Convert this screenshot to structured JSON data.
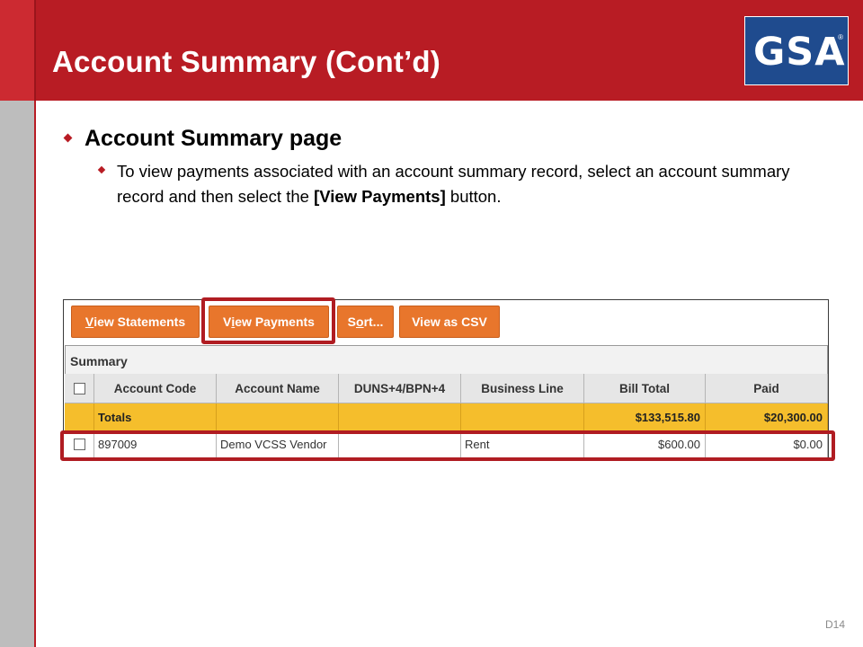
{
  "slide": {
    "title": "Account Summary (Cont’d)",
    "logo": "GSA",
    "logo_mark": "®",
    "bullet1": "Account Summary page",
    "bullet2_pre": "To view payments associated with an account summary record, select an account summary record and then select the ",
    "bullet2_bold": "[View Payments]",
    "bullet2_post": " button.",
    "page_id": "D14"
  },
  "toolbar": {
    "buttons": [
      {
        "underline": "V",
        "rest": "iew Statements"
      },
      {
        "pre": "V",
        "underline": "i",
        "rest": "ew Payments"
      },
      {
        "pre": "S",
        "underline": "o",
        "rest": "rt..."
      },
      {
        "label": "View as CSV"
      }
    ]
  },
  "grid": {
    "title": "Summary",
    "columns": [
      "Account Code",
      "Account Name",
      "DUNS+4/BPN+4",
      "Business Line",
      "Bill Total",
      "Paid"
    ],
    "totals": {
      "label": "Totals",
      "bill_total": "$133,515.80",
      "paid": "$20,300.00"
    },
    "rows": [
      {
        "account_code": "897009",
        "account_name": "Demo VCSS Vendor",
        "duns": "",
        "business_line": "Rent",
        "bill_total": "$600.00",
        "paid": "$0.00"
      }
    ]
  },
  "colors": {
    "header_red": "#b81c24",
    "button_orange": "#e8762c",
    "totals_yellow": "#f5be2c",
    "highlight_red": "#b01c22",
    "logo_blue": "#1f4b8e"
  }
}
